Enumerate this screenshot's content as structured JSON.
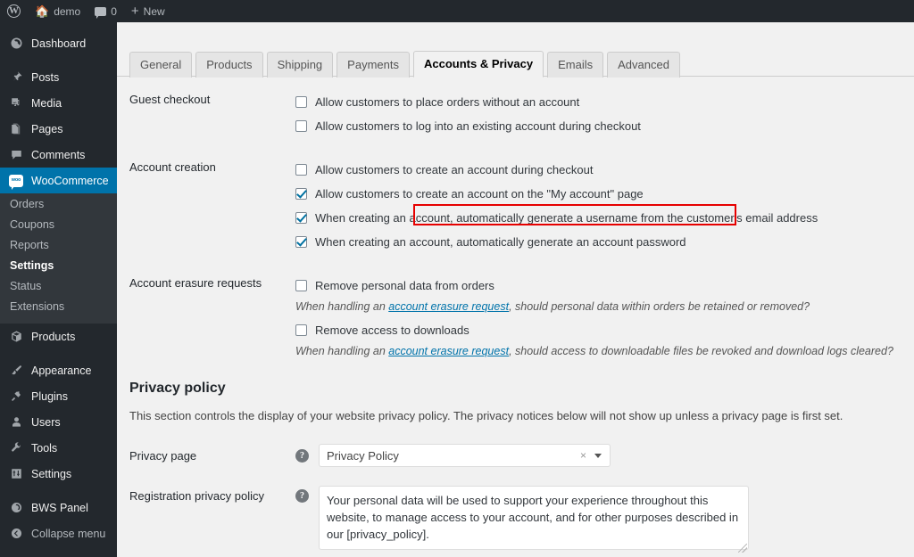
{
  "adminbar": {
    "logo_icon": "wordpress-logo-icon",
    "logo_glyph": "W",
    "site_icon": "home-icon",
    "site_name": "demo",
    "comments_icon": "comment-bubble-icon",
    "comments_count": "0",
    "new_icon": "plus-icon",
    "new_label": "New"
  },
  "sidebar": {
    "items": [
      {
        "label": "Dashboard",
        "icon": "dashboard-icon",
        "glyph": "⌘",
        "current": false,
        "gap_after": true
      },
      {
        "label": "Posts",
        "icon": "pin-icon",
        "glyph": "✎",
        "current": false,
        "gap_after": false
      },
      {
        "label": "Media",
        "icon": "media-icon",
        "glyph": "♫",
        "current": false,
        "gap_after": false
      },
      {
        "label": "Pages",
        "icon": "pages-icon",
        "glyph": "❐",
        "current": false,
        "gap_after": false
      },
      {
        "label": "Comments",
        "icon": "comments-icon",
        "glyph": "■",
        "current": false,
        "gap_after": false
      },
      {
        "label": "WooCommerce",
        "icon": "woocommerce-icon",
        "glyph": "woo",
        "current": true,
        "gap_after": false
      },
      {
        "label": "Products",
        "icon": "products-box-icon",
        "glyph": "⬡",
        "current": false,
        "gap_after": true
      },
      {
        "label": "Appearance",
        "icon": "appearance-brush-icon",
        "glyph": "✎",
        "current": false,
        "gap_after": false
      },
      {
        "label": "Plugins",
        "icon": "plugins-plug-icon",
        "glyph": "⚒",
        "current": false,
        "gap_after": false
      },
      {
        "label": "Users",
        "icon": "users-icon",
        "glyph": "♟",
        "current": false,
        "gap_after": false
      },
      {
        "label": "Tools",
        "icon": "tools-wrench-icon",
        "glyph": "⚒",
        "current": false,
        "gap_after": false
      },
      {
        "label": "Settings",
        "icon": "settings-sliders-icon",
        "glyph": "☲",
        "current": false,
        "gap_after": true
      },
      {
        "label": "BWS Panel",
        "icon": "bws-panel-icon",
        "glyph": "◉",
        "current": false,
        "gap_after": false
      },
      {
        "label": "Collapse menu",
        "icon": "collapse-menu-icon",
        "glyph": "◀",
        "current": false,
        "gap_after": false
      }
    ],
    "submenu": [
      {
        "label": "Orders",
        "current": false
      },
      {
        "label": "Coupons",
        "current": false
      },
      {
        "label": "Reports",
        "current": false
      },
      {
        "label": "Settings",
        "current": true
      },
      {
        "label": "Status",
        "current": false
      },
      {
        "label": "Extensions",
        "current": false
      }
    ]
  },
  "tabs": [
    {
      "label": "General",
      "active": false
    },
    {
      "label": "Products",
      "active": false
    },
    {
      "label": "Shipping",
      "active": false
    },
    {
      "label": "Payments",
      "active": false
    },
    {
      "label": "Accounts & Privacy",
      "active": true
    },
    {
      "label": "Emails",
      "active": false
    },
    {
      "label": "Advanced",
      "active": false
    }
  ],
  "settings": {
    "guest_checkout": {
      "heading": "Guest checkout",
      "options": [
        {
          "label": "Allow customers to place orders without an account",
          "checked": false
        },
        {
          "label": "Allow customers to log into an existing account during checkout",
          "checked": false
        }
      ]
    },
    "account_creation": {
      "heading": "Account creation",
      "options": [
        {
          "label": "Allow customers to create an account during checkout",
          "checked": false,
          "highlighted": false
        },
        {
          "label": "Allow customers to create an account on the \"My account\" page",
          "checked": true,
          "highlighted": true
        },
        {
          "label": "When creating an account, automatically generate a username from the customer's email address",
          "checked": true,
          "highlighted": false
        },
        {
          "label": "When creating an account, automatically generate an account password",
          "checked": true,
          "highlighted": false
        }
      ]
    },
    "account_erasure": {
      "heading": "Account erasure requests",
      "option_1": {
        "label": "Remove personal data from orders",
        "checked": false
      },
      "hint_1_pre": "When handling an ",
      "hint_1_link": "account erasure request",
      "hint_1_post": ", should personal data within orders be retained or removed?",
      "option_2": {
        "label": "Remove access to downloads",
        "checked": false
      },
      "hint_2_pre": "When handling an ",
      "hint_2_link": "account erasure request",
      "hint_2_post": ", should access to downloadable files be revoked and download logs cleared?"
    }
  },
  "privacy": {
    "section_title": "Privacy policy",
    "section_desc": "This section controls the display of your website privacy policy. The privacy notices below will not show up unless a privacy page is first set.",
    "page_label": "Privacy page",
    "page_help_icon": "help-question-icon",
    "page_value": "Privacy Policy",
    "clear_icon": "clear-x-icon",
    "clear_glyph": "×",
    "dropdown_icon": "chevron-down-icon",
    "reg_label": "Registration privacy policy",
    "reg_help_icon": "help-question-icon",
    "reg_value": "Your personal data will be used to support your experience throughout this website, to manage access to your account, and for other purposes described in our [privacy_policy]."
  },
  "colors": {
    "admin_bar": "#23282d",
    "sidebar": "#23282d",
    "submenu": "#32373c",
    "accent_blue": "#0073aa",
    "link_blue": "#0073aa",
    "highlight_red": "#e60000",
    "page_bg": "#f1f1f1"
  }
}
